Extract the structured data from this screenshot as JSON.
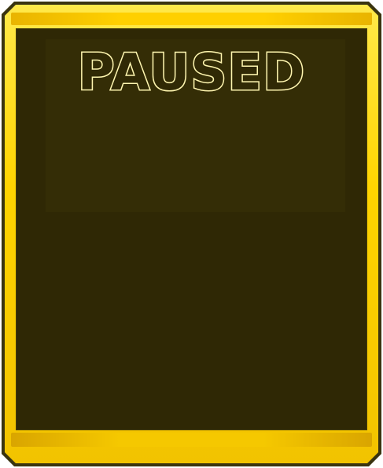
{
  "pause_menu": {
    "title": "PAUSED"
  },
  "colors": {
    "frame_gold": "#ffd400",
    "frame_dark": "#3a3410",
    "panel_background": "#2f2805",
    "title_outline": "#fff6b0"
  }
}
